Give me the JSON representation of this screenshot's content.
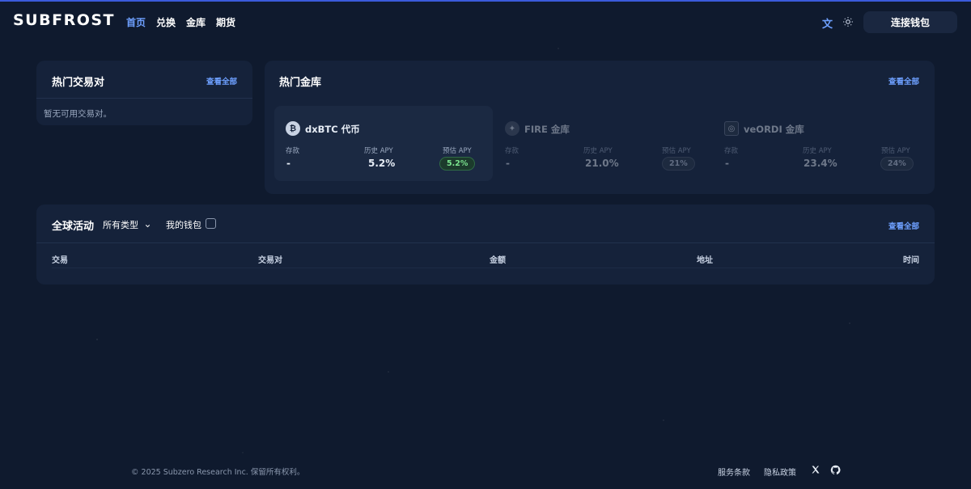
{
  "header": {
    "logo": "SUBFROST",
    "nav": [
      "首页",
      "兑换",
      "金库",
      "期货"
    ],
    "active_nav": "首页",
    "language_label": "文",
    "connect_wallet": "连接钱包"
  },
  "trading_pairs": {
    "title": "热门交易对",
    "view_all": "查看全部",
    "empty_text": "暂无可用交易对。"
  },
  "vaults": {
    "title": "热门金库",
    "view_all": "查看全部",
    "labels": {
      "deposit": "存款",
      "historical_apy": "历史 APY",
      "estimated_apy": "预估 APY"
    },
    "items": [
      {
        "name": "dxBTC 代币",
        "icon": "bitcoin-icon",
        "deposit": "-",
        "historical_apy": "5.2%",
        "estimated_apy": "5.2%"
      },
      {
        "name": "FIRE 金库",
        "icon": "fire-icon",
        "deposit": "-",
        "historical_apy": "21.0%",
        "estimated_apy": "21%"
      },
      {
        "name": "veORDI 金库",
        "icon": "ordi-icon",
        "deposit": "-",
        "historical_apy": "23.4%",
        "estimated_apy": "24%"
      }
    ]
  },
  "activity": {
    "title": "全球活动",
    "filter_label": "所有类型",
    "my_wallet_label": "我的钱包",
    "my_wallet_checked": false,
    "view_all": "查看全部",
    "columns": [
      "交易",
      "交易对",
      "金额",
      "地址",
      "时间"
    ]
  },
  "footer": {
    "copyright": "© 2025 Subzero Research Inc. 保留所有权利。",
    "terms": "服务条款",
    "privacy": "隐私政策",
    "social": [
      "x-icon",
      "github-icon"
    ]
  },
  "colors": {
    "accent": "#6ea0ff",
    "background": "#0f1a2e",
    "card": "#15223a",
    "success": "#7be38f"
  }
}
